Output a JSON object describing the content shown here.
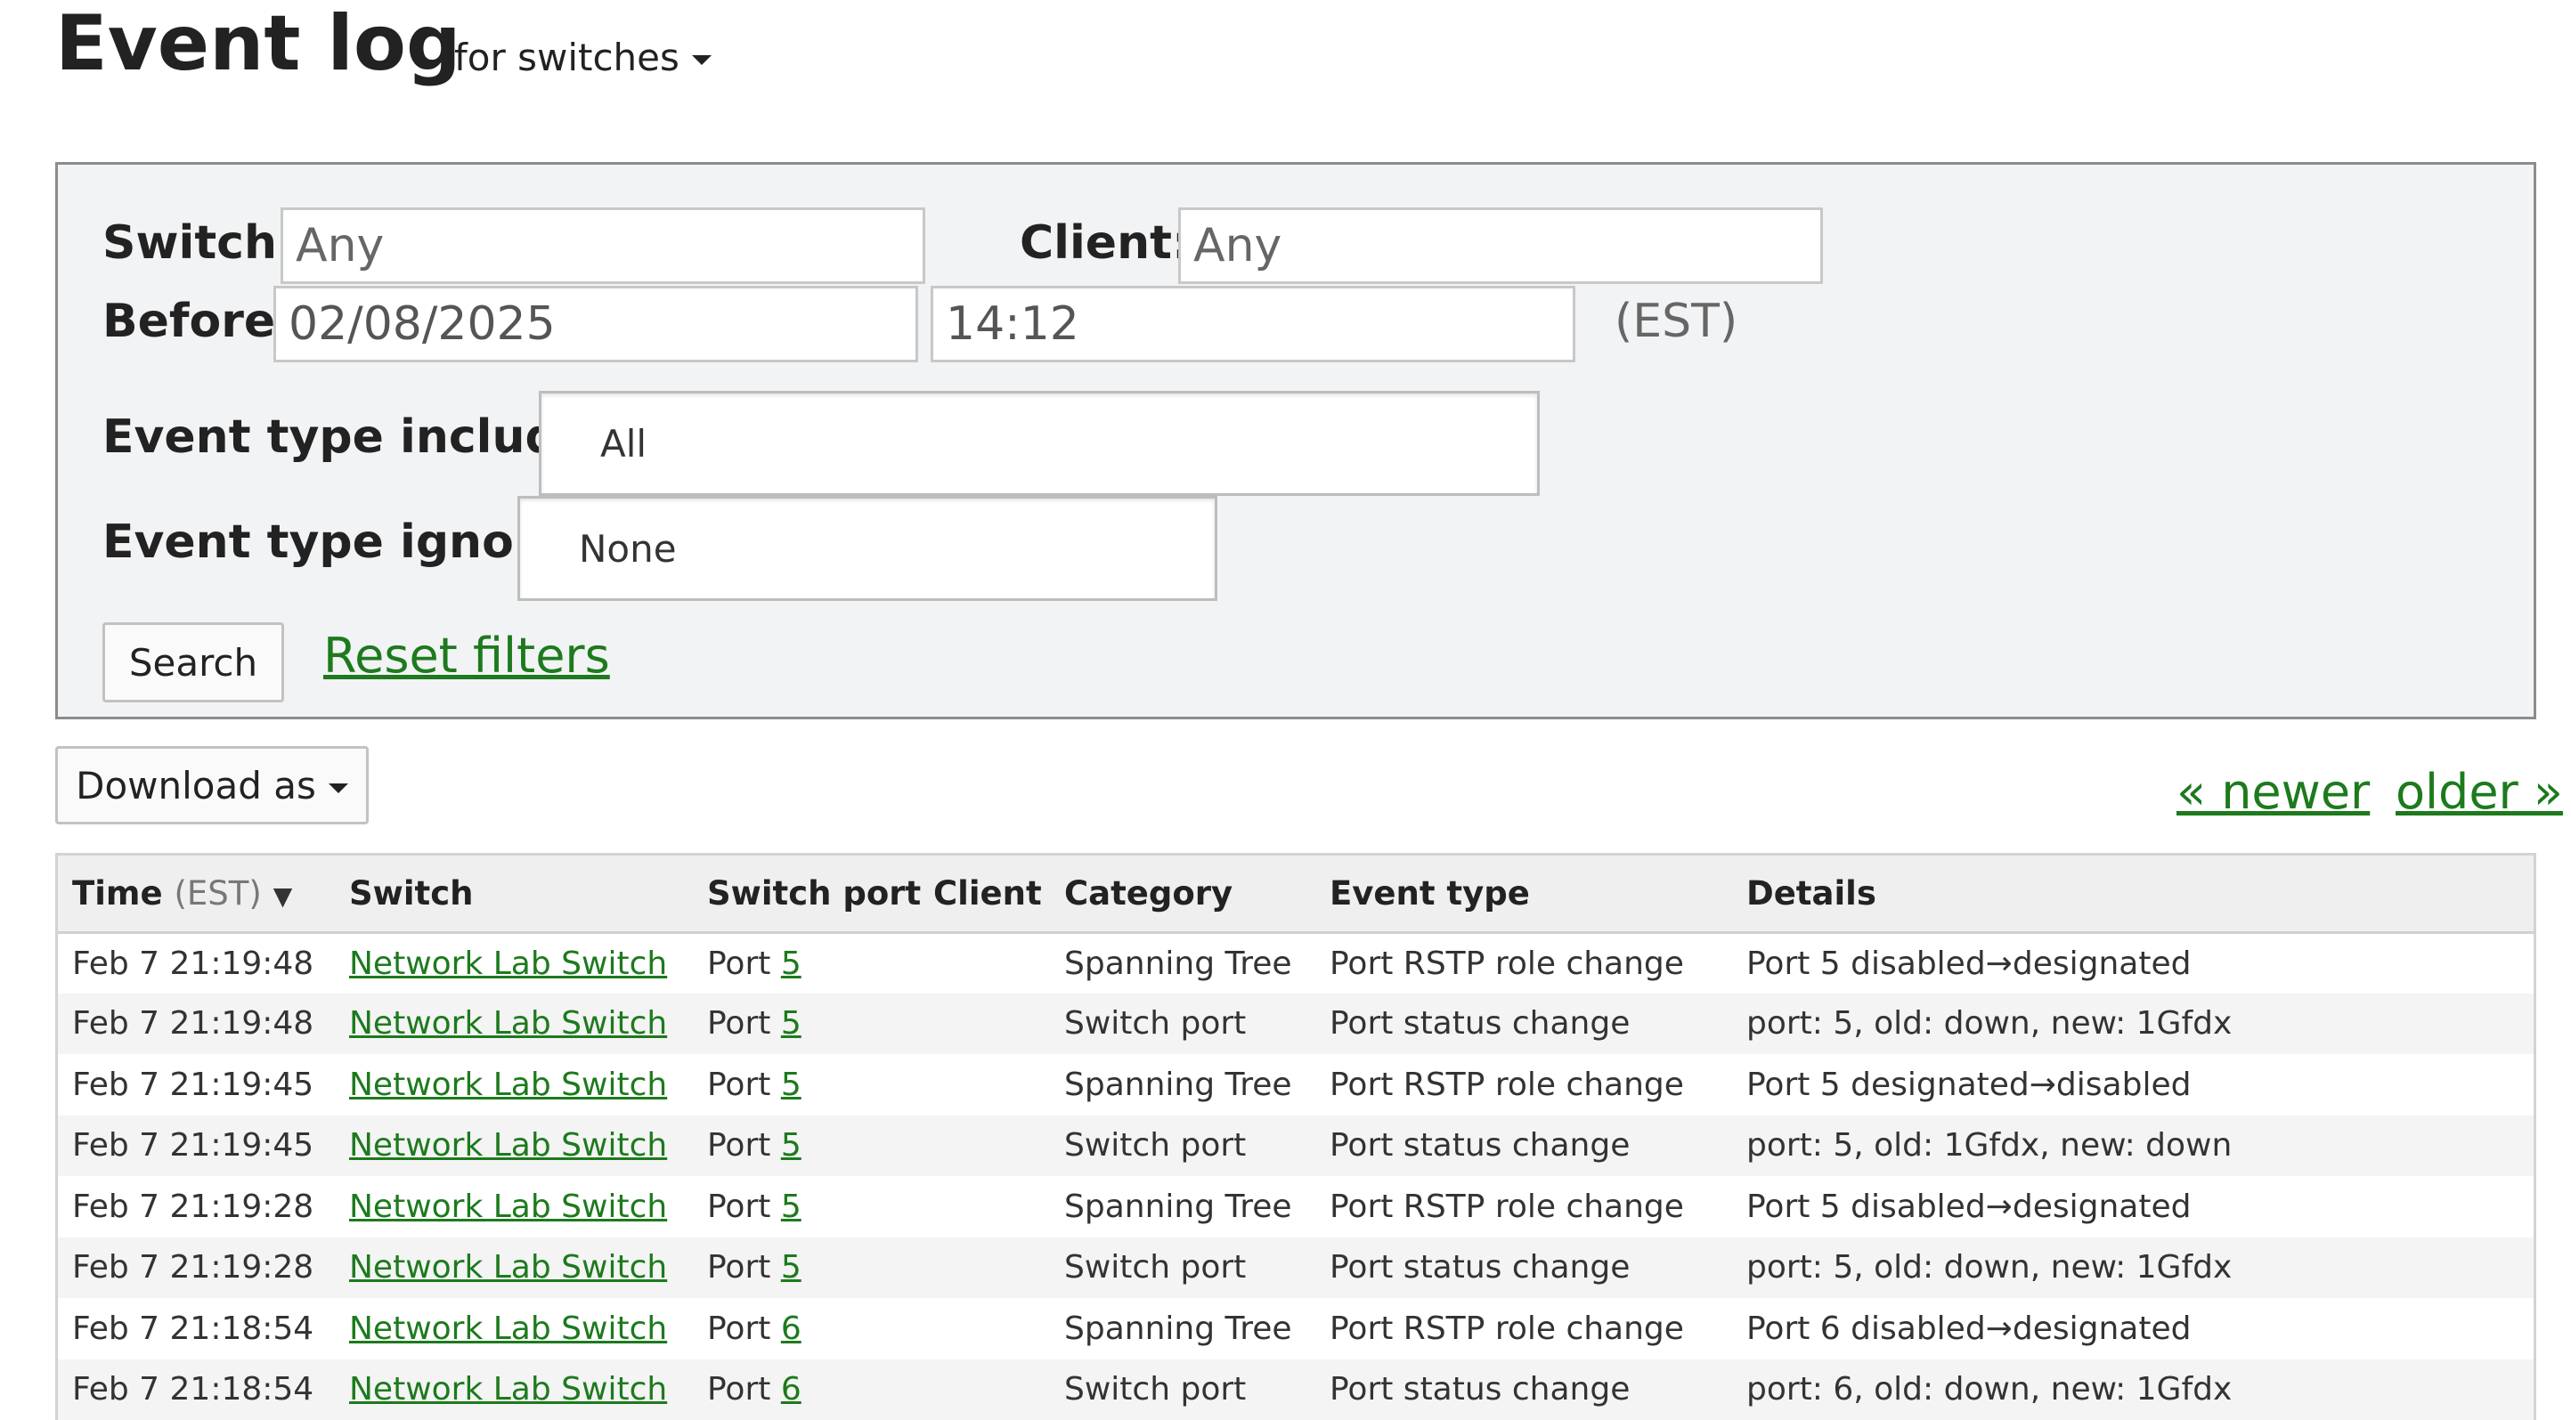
{
  "header": {
    "title": "Event log",
    "scope_label": "for switches"
  },
  "filters": {
    "switch_label": "Switch:",
    "switch_placeholder": "Any",
    "client_label": "Client:",
    "client_placeholder": "Any",
    "before_label": "Before:",
    "before_date": "02/08/2025",
    "before_time": "14:12",
    "timezone": "(EST)",
    "include_label": "Event type include:",
    "include_value": "All",
    "ignore_label": "Event type ignore:",
    "ignore_value": "None",
    "search_label": "Search",
    "reset_label": "Reset filters"
  },
  "toolbar": {
    "download_label": "Download as",
    "newer_label": "« newer",
    "older_label": "older »"
  },
  "table": {
    "headers": {
      "time": "Time",
      "time_tz": "(EST)",
      "sort_indicator": "▼",
      "switch": "Switch",
      "switch_port": "Switch port",
      "client": "Client",
      "category": "Category",
      "event_type": "Event type",
      "details": "Details"
    },
    "rows": [
      {
        "time": "Feb 7 21:19:48",
        "switch": "Network Lab Switch",
        "port_prefix": "Port ",
        "port": "5",
        "client": "",
        "category": "Spanning Tree",
        "event_type": "Port RSTP role change",
        "details": "Port 5 disabled→designated"
      },
      {
        "time": "Feb 7 21:19:48",
        "switch": "Network Lab Switch",
        "port_prefix": "Port ",
        "port": "5",
        "client": "",
        "category": "Switch port",
        "event_type": "Port status change",
        "details": "port: 5, old: down, new: 1Gfdx"
      },
      {
        "time": "Feb 7 21:19:45",
        "switch": "Network Lab Switch",
        "port_prefix": "Port ",
        "port": "5",
        "client": "",
        "category": "Spanning Tree",
        "event_type": "Port RSTP role change",
        "details": "Port 5 designated→disabled"
      },
      {
        "time": "Feb 7 21:19:45",
        "switch": "Network Lab Switch",
        "port_prefix": "Port ",
        "port": "5",
        "client": "",
        "category": "Switch port",
        "event_type": "Port status change",
        "details": "port: 5, old: 1Gfdx, new: down"
      },
      {
        "time": "Feb 7 21:19:28",
        "switch": "Network Lab Switch",
        "port_prefix": "Port ",
        "port": "5",
        "client": "",
        "category": "Spanning Tree",
        "event_type": "Port RSTP role change",
        "details": "Port 5 disabled→designated"
      },
      {
        "time": "Feb 7 21:19:28",
        "switch": "Network Lab Switch",
        "port_prefix": "Port ",
        "port": "5",
        "client": "",
        "category": "Switch port",
        "event_type": "Port status change",
        "details": "port: 5, old: down, new: 1Gfdx"
      },
      {
        "time": "Feb 7 21:18:54",
        "switch": "Network Lab Switch",
        "port_prefix": "Port ",
        "port": "6",
        "client": "",
        "category": "Spanning Tree",
        "event_type": "Port RSTP role change",
        "details": "Port 6 disabled→designated"
      },
      {
        "time": "Feb 7 21:18:54",
        "switch": "Network Lab Switch",
        "port_prefix": "Port ",
        "port": "6",
        "client": "",
        "category": "Switch port",
        "event_type": "Port status change",
        "details": "port: 6, old: down, new: 1Gfdx"
      }
    ]
  },
  "colors": {
    "link": "#1d7a1d",
    "panel_bg": "#f2f3f5",
    "panel_border": "#8c8c8c"
  },
  "icons": {
    "scope_dropdown": "caret-down-icon",
    "download_dropdown": "caret-down-icon",
    "sort": "sort-descending-icon"
  }
}
